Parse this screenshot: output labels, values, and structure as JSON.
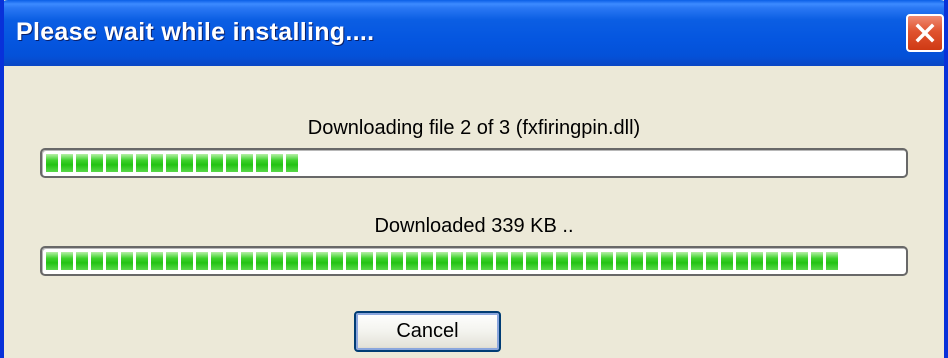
{
  "window": {
    "title": "Please wait while installing....",
    "close_icon": "close-icon"
  },
  "file_status": {
    "label": "Downloading file 2 of 3 (fxfiringpin.dll)",
    "progress_fraction": 0.3
  },
  "download_status": {
    "label": "Downloaded 339 KB ..",
    "progress_fraction": 0.93
  },
  "buttons": {
    "cancel_label": "Cancel"
  },
  "colors": {
    "titlebar": "#0556e0",
    "progress_green": "#22c313",
    "close_red": "#e0532f",
    "dialog_background": "#ece9d8"
  }
}
